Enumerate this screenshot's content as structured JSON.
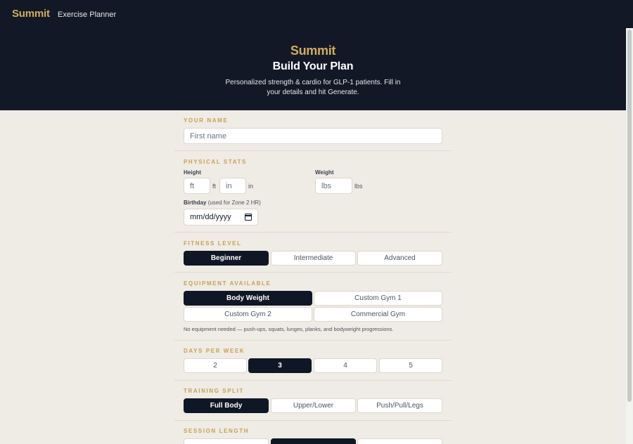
{
  "nav": {
    "logo": "Summit",
    "subtitle": "Exercise Planner"
  },
  "hero": {
    "brand": "Summit",
    "title": "Build Your Plan",
    "description": "Personalized strength & cardio for GLP-1 patients. Fill in your details and hit Generate."
  },
  "name_section": {
    "label": "YOUR NAME",
    "placeholder": "First name",
    "value": ""
  },
  "physical": {
    "label": "PHYSICAL STATS",
    "height_label": "Height",
    "ft_placeholder": "ft",
    "ft_unit": "ft",
    "in_placeholder": "in",
    "in_unit": "in",
    "weight_label": "Weight",
    "lbs_placeholder": "lbs",
    "lbs_unit": "lbs",
    "birthday_label": "Birthday",
    "birthday_hint": "(used for Zone 2 HR)",
    "birthday_placeholder": "mm/dd/yyyy"
  },
  "fitness": {
    "label": "FITNESS LEVEL",
    "options": [
      "Beginner",
      "Intermediate",
      "Advanced"
    ],
    "selected": "Beginner"
  },
  "equipment": {
    "label": "EQUIPMENT AVAILABLE",
    "options": [
      "Body Weight",
      "Custom Gym 1",
      "Custom Gym 2",
      "Commercial Gym"
    ],
    "selected": "Body Weight",
    "note": "No equipment needed — push-ups, squats, lunges, planks, and bodyweight progressions."
  },
  "days": {
    "label": "DAYS PER WEEK",
    "options": [
      "2",
      "3",
      "4",
      "5"
    ],
    "selected": "3"
  },
  "split": {
    "label": "TRAINING SPLIT",
    "options": [
      "Full Body",
      "Upper/Lower",
      "Push/Pull/Legs"
    ],
    "selected": "Full Body"
  },
  "session": {
    "label": "SESSION LENGTH"
  },
  "colors": {
    "dark": "#121826",
    "gold": "#d2ad5d",
    "background": "#efebe5",
    "selected": "#0f1726"
  }
}
